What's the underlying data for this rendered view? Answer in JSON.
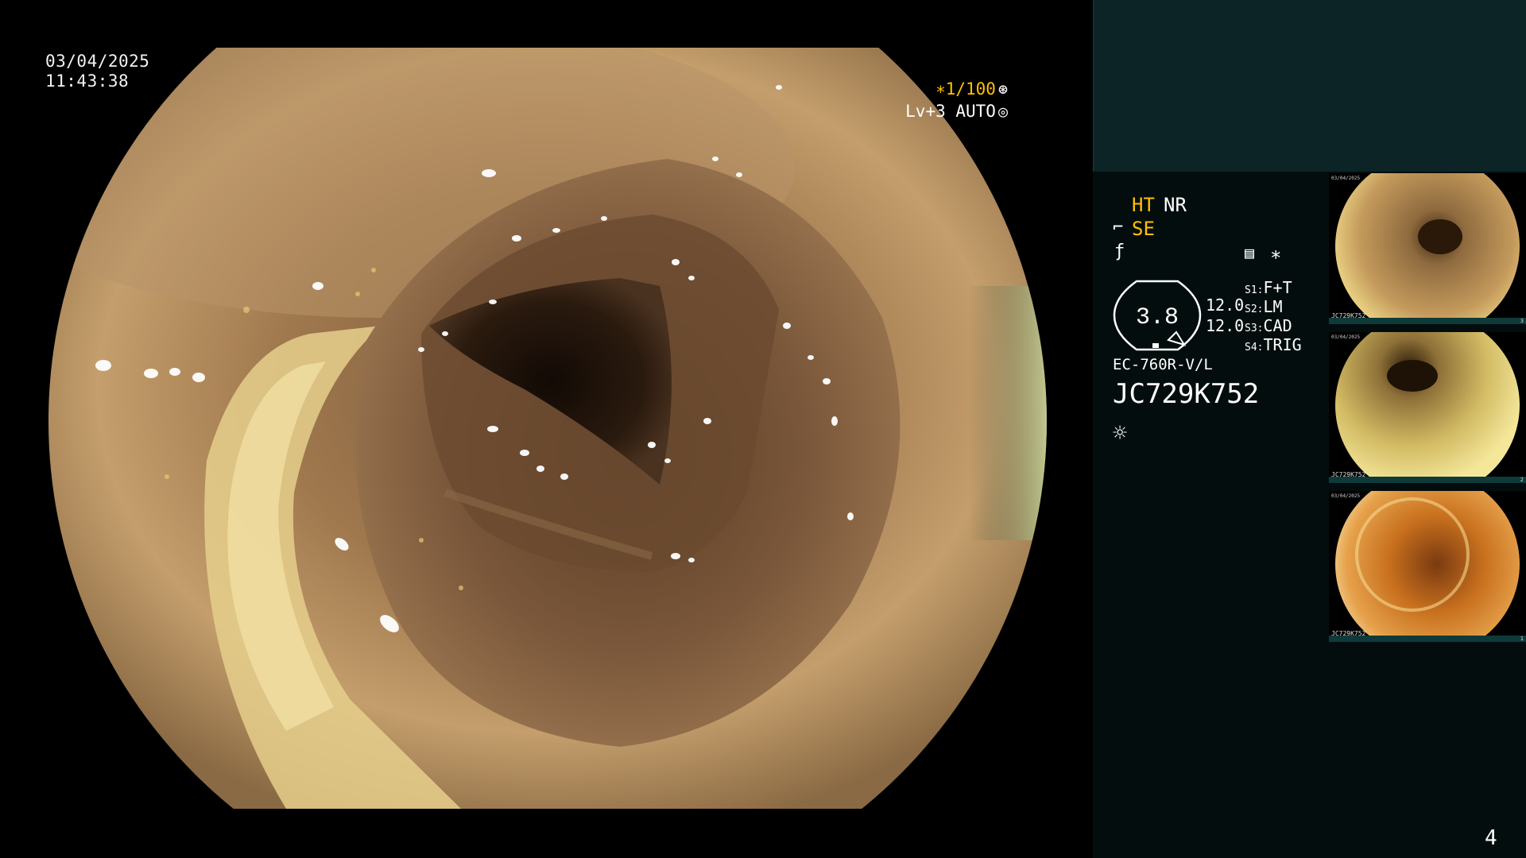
{
  "overlay": {
    "date": "03/04/2025",
    "time": "11:43:38",
    "shutter": "∗1/100",
    "shutter_icon": "aperture-icon",
    "level": "Lv+3 AUTO",
    "level_icon": "iris-icon"
  },
  "panel": {
    "ht": "HT",
    "nr": "NR",
    "se": "SE",
    "gauge_value": "3.8",
    "val1": "12.0",
    "val2": "12.0",
    "switches": [
      {
        "key": "S1:",
        "label": "F+T"
      },
      {
        "key": "S2:",
        "label": "LM"
      },
      {
        "key": "S3:",
        "label": "CAD"
      },
      {
        "key": "S4:",
        "label": "TRIG"
      }
    ],
    "scope_model": "EC-760R-V/L",
    "serial": "JC729K752",
    "star": "∗",
    "icons": [
      "se-probe-icon",
      "enhance-icon",
      "memory-icon",
      "light-source-icon"
    ]
  },
  "thumbnails": [
    {
      "label": "JC729K752",
      "num": "3",
      "date": "03/04/2025",
      "tone": "#b08a52"
    },
    {
      "label": "JC729K752",
      "num": "2",
      "date": "03/04/2025",
      "tone": "#c9b259"
    },
    {
      "label": "JC729K752",
      "num": "1",
      "date": "03/04/2025",
      "tone": "#d1782a"
    }
  ],
  "page_number": "4",
  "colors": {
    "accent_yellow": "#ffc000",
    "panel_top": "#0d2426",
    "panel_bg": "#040d0d"
  }
}
